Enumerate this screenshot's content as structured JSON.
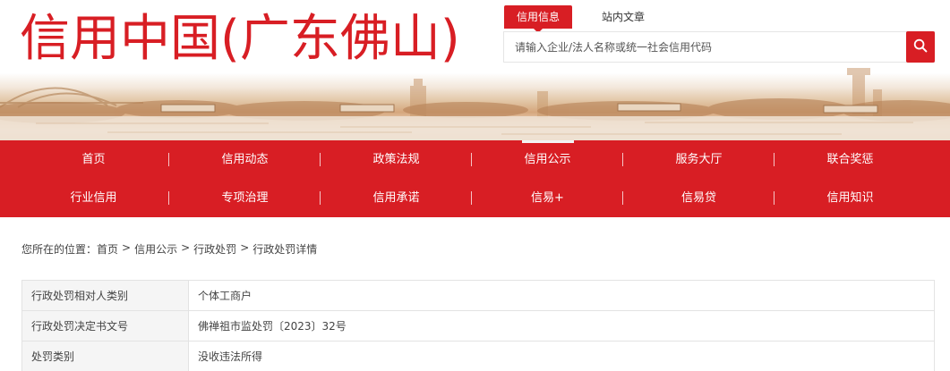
{
  "site": {
    "title": "信用中国(广东佛山)"
  },
  "search": {
    "tabs": [
      "信用信息",
      "站内文章"
    ],
    "placeholder": "请输入企业/法人名称或统一社会信用代码"
  },
  "nav": {
    "row1": [
      "首页",
      "信用动态",
      "政策法规",
      "信用公示",
      "服务大厅",
      "联合奖惩"
    ],
    "row2": [
      "行业信用",
      "专项治理",
      "信用承诺",
      "信易+",
      "信易贷",
      "信用知识"
    ],
    "active": "信用公示"
  },
  "breadcrumb": {
    "prefix": "您所在的位置：",
    "items": [
      "首页",
      "信用公示",
      "行政处罚",
      "行政处罚详情"
    ],
    "separator": ">"
  },
  "details": [
    {
      "label": "行政处罚相对人类别",
      "value": "个体工商户"
    },
    {
      "label": "行政处罚决定书文号",
      "value": "佛禅祖市监处罚〔2023〕32号"
    },
    {
      "label": "处罚类别",
      "value": "没收违法所得"
    }
  ],
  "colors": {
    "brand_red": "#d81e24"
  },
  "icons": {
    "search_button": "search-icon"
  }
}
